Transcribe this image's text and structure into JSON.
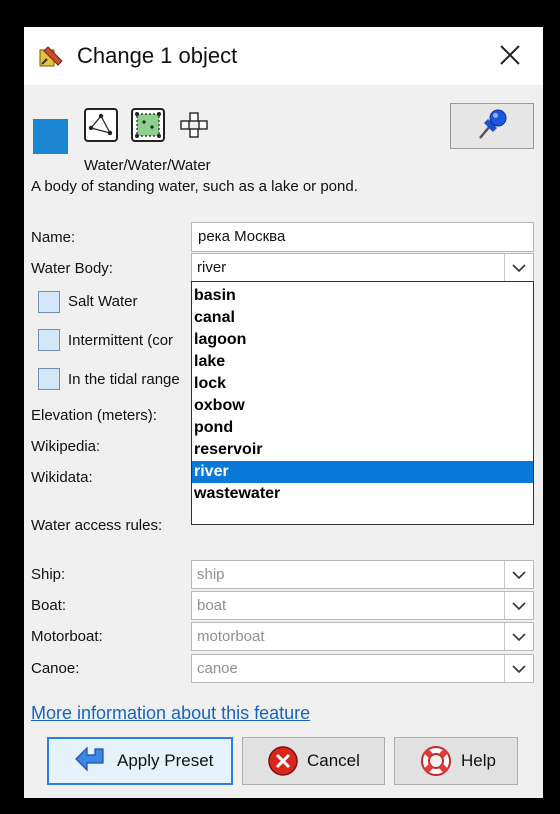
{
  "window": {
    "title": "Change 1 object",
    "close_icon": "close-icon"
  },
  "preset": {
    "color": "#1a86d1",
    "geometry_icons": [
      "node-icon",
      "way-icon",
      "area-icon",
      "relation-icon"
    ],
    "path": "Water/Water/Water",
    "description": "A body of standing water, such as a lake or pond.",
    "pin_icon": "pushpin-icon"
  },
  "form": {
    "name_label": "Name:",
    "name_value": "река Москва",
    "water_body_label": "Water Body:",
    "water_body_value": "river",
    "salt_water_label": "Salt Water",
    "intermittent_label": "Intermittent (cor",
    "tidal_label": "In the tidal range",
    "elevation_label": "Elevation (meters):",
    "wikipedia_label": "Wikipedia:",
    "wikidata_label": "Wikidata:",
    "access_label": "Water access rules:",
    "ship_label": "Ship:",
    "ship_value": "ship",
    "boat_label": "Boat:",
    "boat_value": "boat",
    "motorboat_label": "Motorboat:",
    "motorboat_value": "motorboat",
    "canoe_label": "Canoe:",
    "canoe_value": "canoe"
  },
  "dropdown": {
    "options": [
      "basin",
      "canal",
      "lagoon",
      "lake",
      "lock",
      "oxbow",
      "pond",
      "reservoir",
      "river",
      "wastewater"
    ],
    "selected": "river"
  },
  "link": {
    "more_info": "More information about this feature"
  },
  "buttons": {
    "apply": "Apply Preset",
    "cancel": "Cancel",
    "help": "Help"
  },
  "colors": {
    "selection": "#0a78d7",
    "link": "#1565c0",
    "primary_border": "#2a7de1"
  }
}
